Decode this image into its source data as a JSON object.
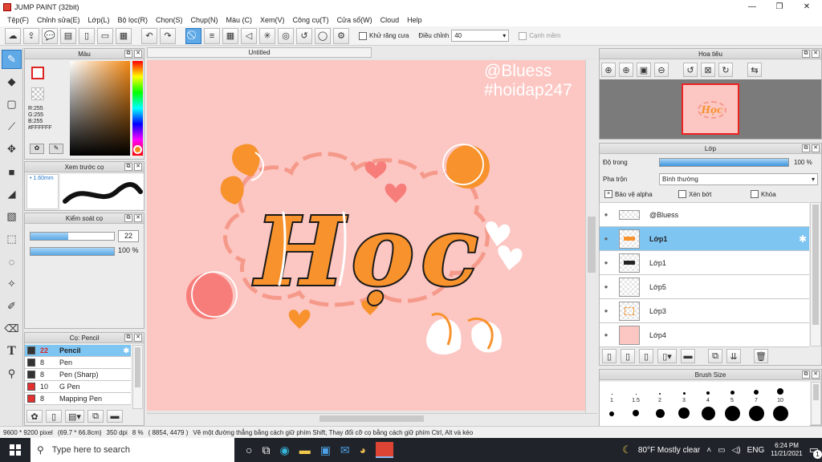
{
  "window": {
    "title": "JUMP PAINT (32bit)",
    "minimize": "—",
    "restore": "❐",
    "close": "✕"
  },
  "menu": [
    "Tệp(F)",
    "Chỉnh sửa(E)",
    "Lớp(L)",
    "Bộ lọc(R)",
    "Chọn(S)",
    "Chụp(N)",
    "Màu (C)",
    "Xem(V)",
    "Công cụ(T)",
    "Cửa sổ(W)",
    "Cloud",
    "Help"
  ],
  "toolbar": {
    "antialias_label": "Khử răng cưa",
    "adjust_label": "Điều chỉnh",
    "adjust_value": "40",
    "snap_label": "Cạnh mềm"
  },
  "color_panel": {
    "title": "Màu",
    "r": "R:255",
    "g": "G:255",
    "b": "B:255",
    "hex": "#FFFFFF"
  },
  "brush_preview": {
    "title": "Xem trước cọ",
    "size": "1.60mm"
  },
  "brush_control": {
    "title": "Kiểm soát cọ",
    "size_value": "22",
    "opacity_value": "100 %",
    "size_fraction": 0.45,
    "opacity_fraction": 1.0
  },
  "brush_list": {
    "title": "Cọ: Pencil",
    "items": [
      {
        "size": "22",
        "name": "Pencil",
        "color": "#333333",
        "active": true
      },
      {
        "size": "8",
        "name": "Pen",
        "color": "#333333",
        "active": false
      },
      {
        "size": "8",
        "name": "Pen (Sharp)",
        "color": "#333333",
        "active": false
      },
      {
        "size": "10",
        "name": "G Pen",
        "color": "#e53030",
        "active": false
      },
      {
        "size": "8",
        "name": "Mapping Pen",
        "color": "#e53030",
        "active": false
      }
    ]
  },
  "document": {
    "tab_title": "Untitled"
  },
  "canvas": {
    "watermark_line1": "@Bluess",
    "watermark_line2": "#hoidap247",
    "art_text": "Học"
  },
  "navigator": {
    "title": "Hoa tiêu"
  },
  "layers_panel": {
    "title": "Lớp",
    "opacity_label": "Độ trong",
    "opacity_value": "100 %",
    "blend_label": "Pha trộn",
    "blend_value": "Bình thường",
    "protect_alpha": "Bảo vệ alpha",
    "clipping": "Xén bớt",
    "lock": "Khóa",
    "layers": [
      {
        "name": "@Bluess",
        "active": false
      },
      {
        "name": "Lớp1",
        "active": true
      },
      {
        "name": "Lớp1",
        "active": false
      },
      {
        "name": "Lớp5",
        "active": false
      },
      {
        "name": "Lớp3",
        "active": false
      },
      {
        "name": "Lớp4",
        "active": false
      }
    ]
  },
  "brush_size_panel": {
    "title": "Brush Size",
    "sizes": [
      "1",
      "1.5",
      "2",
      "3",
      "4",
      "5",
      "7",
      "10"
    ]
  },
  "status": {
    "dimensions": "9600 * 9200 pixel",
    "physical": "(69.7 * 66.8cm)",
    "dpi": "350 dpi",
    "zoom": "8 %",
    "coords": "( 8854, 4479 )",
    "hint": "Vẽ một đường thẳng bằng cách giữ phím Shift, Thay đổi cỡ cọ bằng cách giữ phím Ctrl, Alt và kéo"
  },
  "taskbar": {
    "search_placeholder": "Type here to search",
    "weather": "80°F  Mostly clear",
    "lang": "ENG",
    "time": "6:24 PM",
    "date": "11/21/2021",
    "notif_count": "1"
  }
}
